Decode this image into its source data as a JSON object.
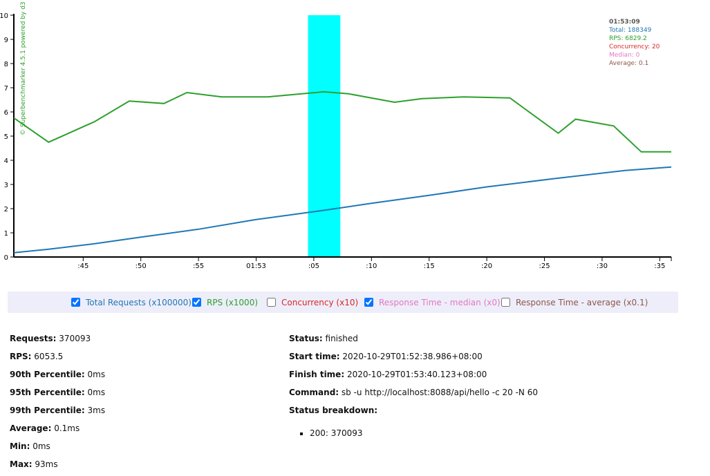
{
  "chart_data": {
    "type": "line",
    "x_tick_labels": [
      ":45",
      ":50",
      ":55",
      "01:53",
      ":05",
      ":10",
      ":15",
      ":20",
      ":25",
      ":30",
      ":35"
    ],
    "y_ticks": [
      0,
      1,
      2,
      3,
      4,
      5,
      6,
      7,
      8,
      9,
      10
    ],
    "ylim": [
      0,
      10
    ],
    "x_range_seconds": [
      38.986,
      96
    ],
    "x_ticks_seconds": [
      45,
      50,
      55,
      60,
      65,
      70,
      75,
      80,
      85,
      90,
      95
    ],
    "highlight_seconds": [
      64.5,
      67.3
    ],
    "highlight_color": "#00ffff",
    "watermark": "© Superbenchmarker 4.5.1 powered by d3",
    "series": [
      {
        "name": "RPS",
        "color": "#2ca02c",
        "x": [
          39,
          42,
          46,
          49,
          52,
          54,
          57,
          61,
          63.3,
          65.9,
          68,
          72,
          74.4,
          78,
          82,
          86.2,
          87.7,
          91,
          93.4,
          96
        ],
        "y": [
          5.75,
          4.75,
          5.6,
          6.45,
          6.35,
          6.8,
          6.62,
          6.62,
          6.72,
          6.83,
          6.75,
          6.4,
          6.55,
          6.62,
          6.58,
          5.12,
          5.7,
          5.42,
          4.35,
          4.35
        ]
      },
      {
        "name": "Total Requests",
        "color": "#1f77b4",
        "x": [
          39,
          42,
          46,
          50,
          55,
          60,
          65.9,
          70,
          75,
          80,
          86,
          92,
          96
        ],
        "y": [
          0.18,
          0.32,
          0.55,
          0.82,
          1.15,
          1.55,
          1.93,
          2.22,
          2.55,
          2.9,
          3.25,
          3.58,
          3.72
        ]
      }
    ]
  },
  "tooltip": {
    "time": "01:53:09",
    "total": "Total: 188349",
    "rps": "RPS: 6829.2",
    "concurrency": "Concurrency: 20",
    "median": "Median: 0",
    "average": "Average: 0.1",
    "colors": {
      "time": "#555555",
      "total": "#1f77b4",
      "rps": "#2ca02c",
      "concurrency": "#d62728",
      "median": "#e377c2",
      "average": "#8c564b"
    }
  },
  "legend": [
    {
      "label": "Total Requests (x100000)",
      "checked": true,
      "color": "#1f77b4"
    },
    {
      "label": "RPS (x1000)",
      "checked": true,
      "color": "#2ca02c"
    },
    {
      "label": "Concurrency (x10)",
      "checked": false,
      "color": "#d62728"
    },
    {
      "label": "Response Time - median (x0)",
      "checked": true,
      "color": "#e377c2"
    },
    {
      "label": "Response Time - average (x0.1)",
      "checked": false,
      "color": "#8c564b"
    }
  ],
  "stats_left": [
    {
      "label": "Requests:",
      "value": "370093"
    },
    {
      "label": "RPS:",
      "value": "6053.5"
    },
    {
      "label": "90th Percentile:",
      "value": "0ms"
    },
    {
      "label": "95th Percentile:",
      "value": "0ms"
    },
    {
      "label": "99th Percentile:",
      "value": "3ms"
    },
    {
      "label": "Average:",
      "value": "0.1ms"
    },
    {
      "label": "Min:",
      "value": "0ms"
    },
    {
      "label": "Max:",
      "value": "93ms"
    }
  ],
  "stats_right": [
    {
      "label": "Status:",
      "value": "finished"
    },
    {
      "label": "Start time:",
      "value": "2020-10-29T01:52:38.986+08:00"
    },
    {
      "label": "Finish time:",
      "value": "2020-10-29T01:53:40.123+08:00"
    },
    {
      "label": "Command:",
      "value": "sb -u http://localhost:8088/api/hello -c 20 -N 60"
    },
    {
      "label": "Status breakdown:",
      "value": ""
    }
  ],
  "status_breakdown": [
    "200: 370093"
  ]
}
